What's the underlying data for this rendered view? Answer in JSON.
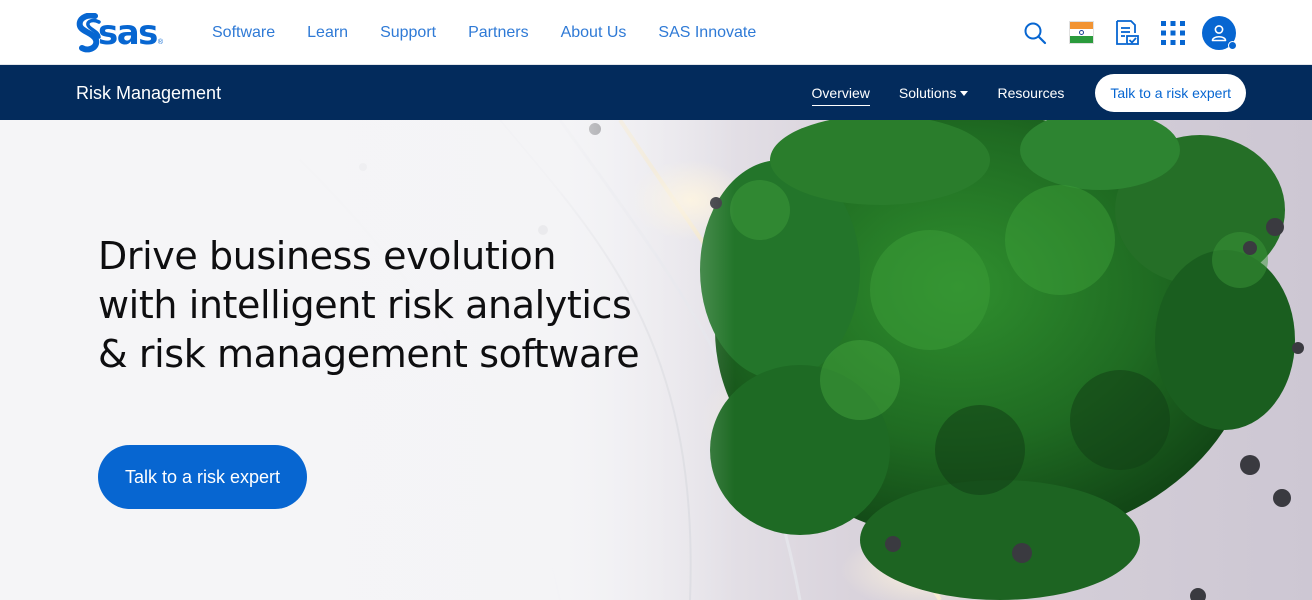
{
  "brand": {
    "logo_text": "sas",
    "logo_mark": "®",
    "color": "#0766d1"
  },
  "nav": {
    "items": [
      {
        "label": "Software"
      },
      {
        "label": "Learn"
      },
      {
        "label": "Support"
      },
      {
        "label": "Partners"
      },
      {
        "label": "About Us"
      },
      {
        "label": "SAS Innovate"
      }
    ],
    "utility_icons": [
      "search-icon",
      "india-flag-icon",
      "trial-checklist-icon",
      "apps-grid-icon",
      "user-account-icon"
    ]
  },
  "subnav": {
    "title": "Risk Management",
    "links": [
      {
        "label": "Overview",
        "active": true
      },
      {
        "label": "Solutions",
        "dropdown": true
      },
      {
        "label": "Resources"
      }
    ],
    "cta_label": "Talk to a risk expert",
    "background": "#032b5c"
  },
  "hero": {
    "headline_lines": [
      "Drive business evolution",
      "with intelligent risk analytics",
      "& risk management software"
    ],
    "cta_label": "Talk to a risk expert",
    "cta_color": "#0766d1"
  }
}
